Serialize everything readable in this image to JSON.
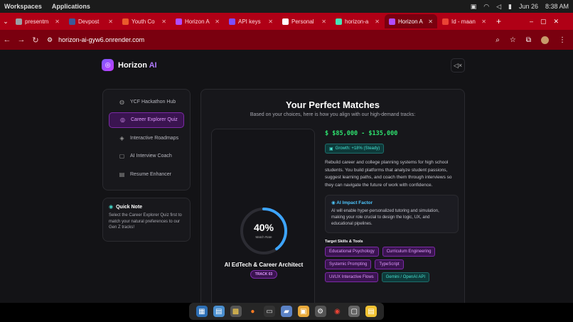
{
  "system_bar": {
    "workspaces": "Workspaces",
    "applications": "Applications",
    "date": "Jun 26",
    "time": "8:38 AM"
  },
  "tabs": [
    {
      "label": "presentm",
      "color": "#9aa0a6"
    },
    {
      "label": "Devpost",
      "color": "#3b5998"
    },
    {
      "label": "Youth Co",
      "color": "#e95b2b"
    },
    {
      "label": "Horizon A",
      "color": "#b04cff"
    },
    {
      "label": "API keys",
      "color": "#7c4dff"
    },
    {
      "label": "Personal",
      "color": "#ffffff"
    },
    {
      "label": "horizon-a",
      "color": "#46e3b7"
    },
    {
      "label": "Horizon A",
      "color": "#b04cff"
    },
    {
      "label": "Id - maan",
      "color": "#ea4335"
    }
  ],
  "active_tab_index": 7,
  "url": "horizon-ai-gyw6.onrender.com",
  "app": {
    "brand": "Horizon",
    "brand_ai": "AI"
  },
  "sidebar": {
    "items": [
      {
        "label": "YCF Hackathon Hub",
        "icon": "globe-icon",
        "glyph": "◍"
      },
      {
        "label": "Career Explorer Quiz",
        "icon": "target-icon",
        "glyph": "◎"
      },
      {
        "label": "Interactive Roadmaps",
        "icon": "layers-icon",
        "glyph": "◈"
      },
      {
        "label": "AI Interview Coach",
        "icon": "chat-icon",
        "glyph": "▢"
      },
      {
        "label": "Resume Enhancer",
        "icon": "document-icon",
        "glyph": "▤"
      }
    ],
    "active_index": 1
  },
  "quick_note": {
    "title": "Quick Note",
    "body": "Select the Career Explorer Quiz first to match your natural preferences to our Gen Z tracks!"
  },
  "results": {
    "title": "Your Perfect Matches",
    "subtitle": "Based on your choices, here is how you align with our high-demand tracks:",
    "match": {
      "percent": 40,
      "percent_label": "40%",
      "match_label": "Match Rate",
      "role": "AI EdTech & Career Architect",
      "track": "TRACK 03"
    },
    "salary": "$ $85,000 - $135,000",
    "growth": "Growth: +18% (Steady)",
    "description": "Rebuild career and college planning systems for high school students. You build platforms that analyze student passions, suggest learning paths, and coach them through interviews so they can navigate the future of work with confidence.",
    "impact": {
      "title": "AI Impact Factor",
      "body": "AI will enable hyper-personalized tutoring and simulation, making your role crucial to design the logic, UX, and educational pipelines."
    },
    "skills_title": "Target Skills & Tools",
    "skills": [
      {
        "label": "Educational Psychology",
        "style": "purple"
      },
      {
        "label": "Curriculum Engineering",
        "style": "purple"
      },
      {
        "label": "Systemic Prompting",
        "style": "purple"
      },
      {
        "label": "TypeScript",
        "style": "purple"
      },
      {
        "label": "UI/UX Interactive Flows",
        "style": "purple"
      },
      {
        "label": "Gemini / OpenAI API",
        "style": "teal"
      }
    ]
  },
  "colors": {
    "accent_purple": "#b04cff",
    "salary_green": "#2ee06e",
    "teal": "#46e0d0",
    "ring_blue": "#3da5ff"
  }
}
